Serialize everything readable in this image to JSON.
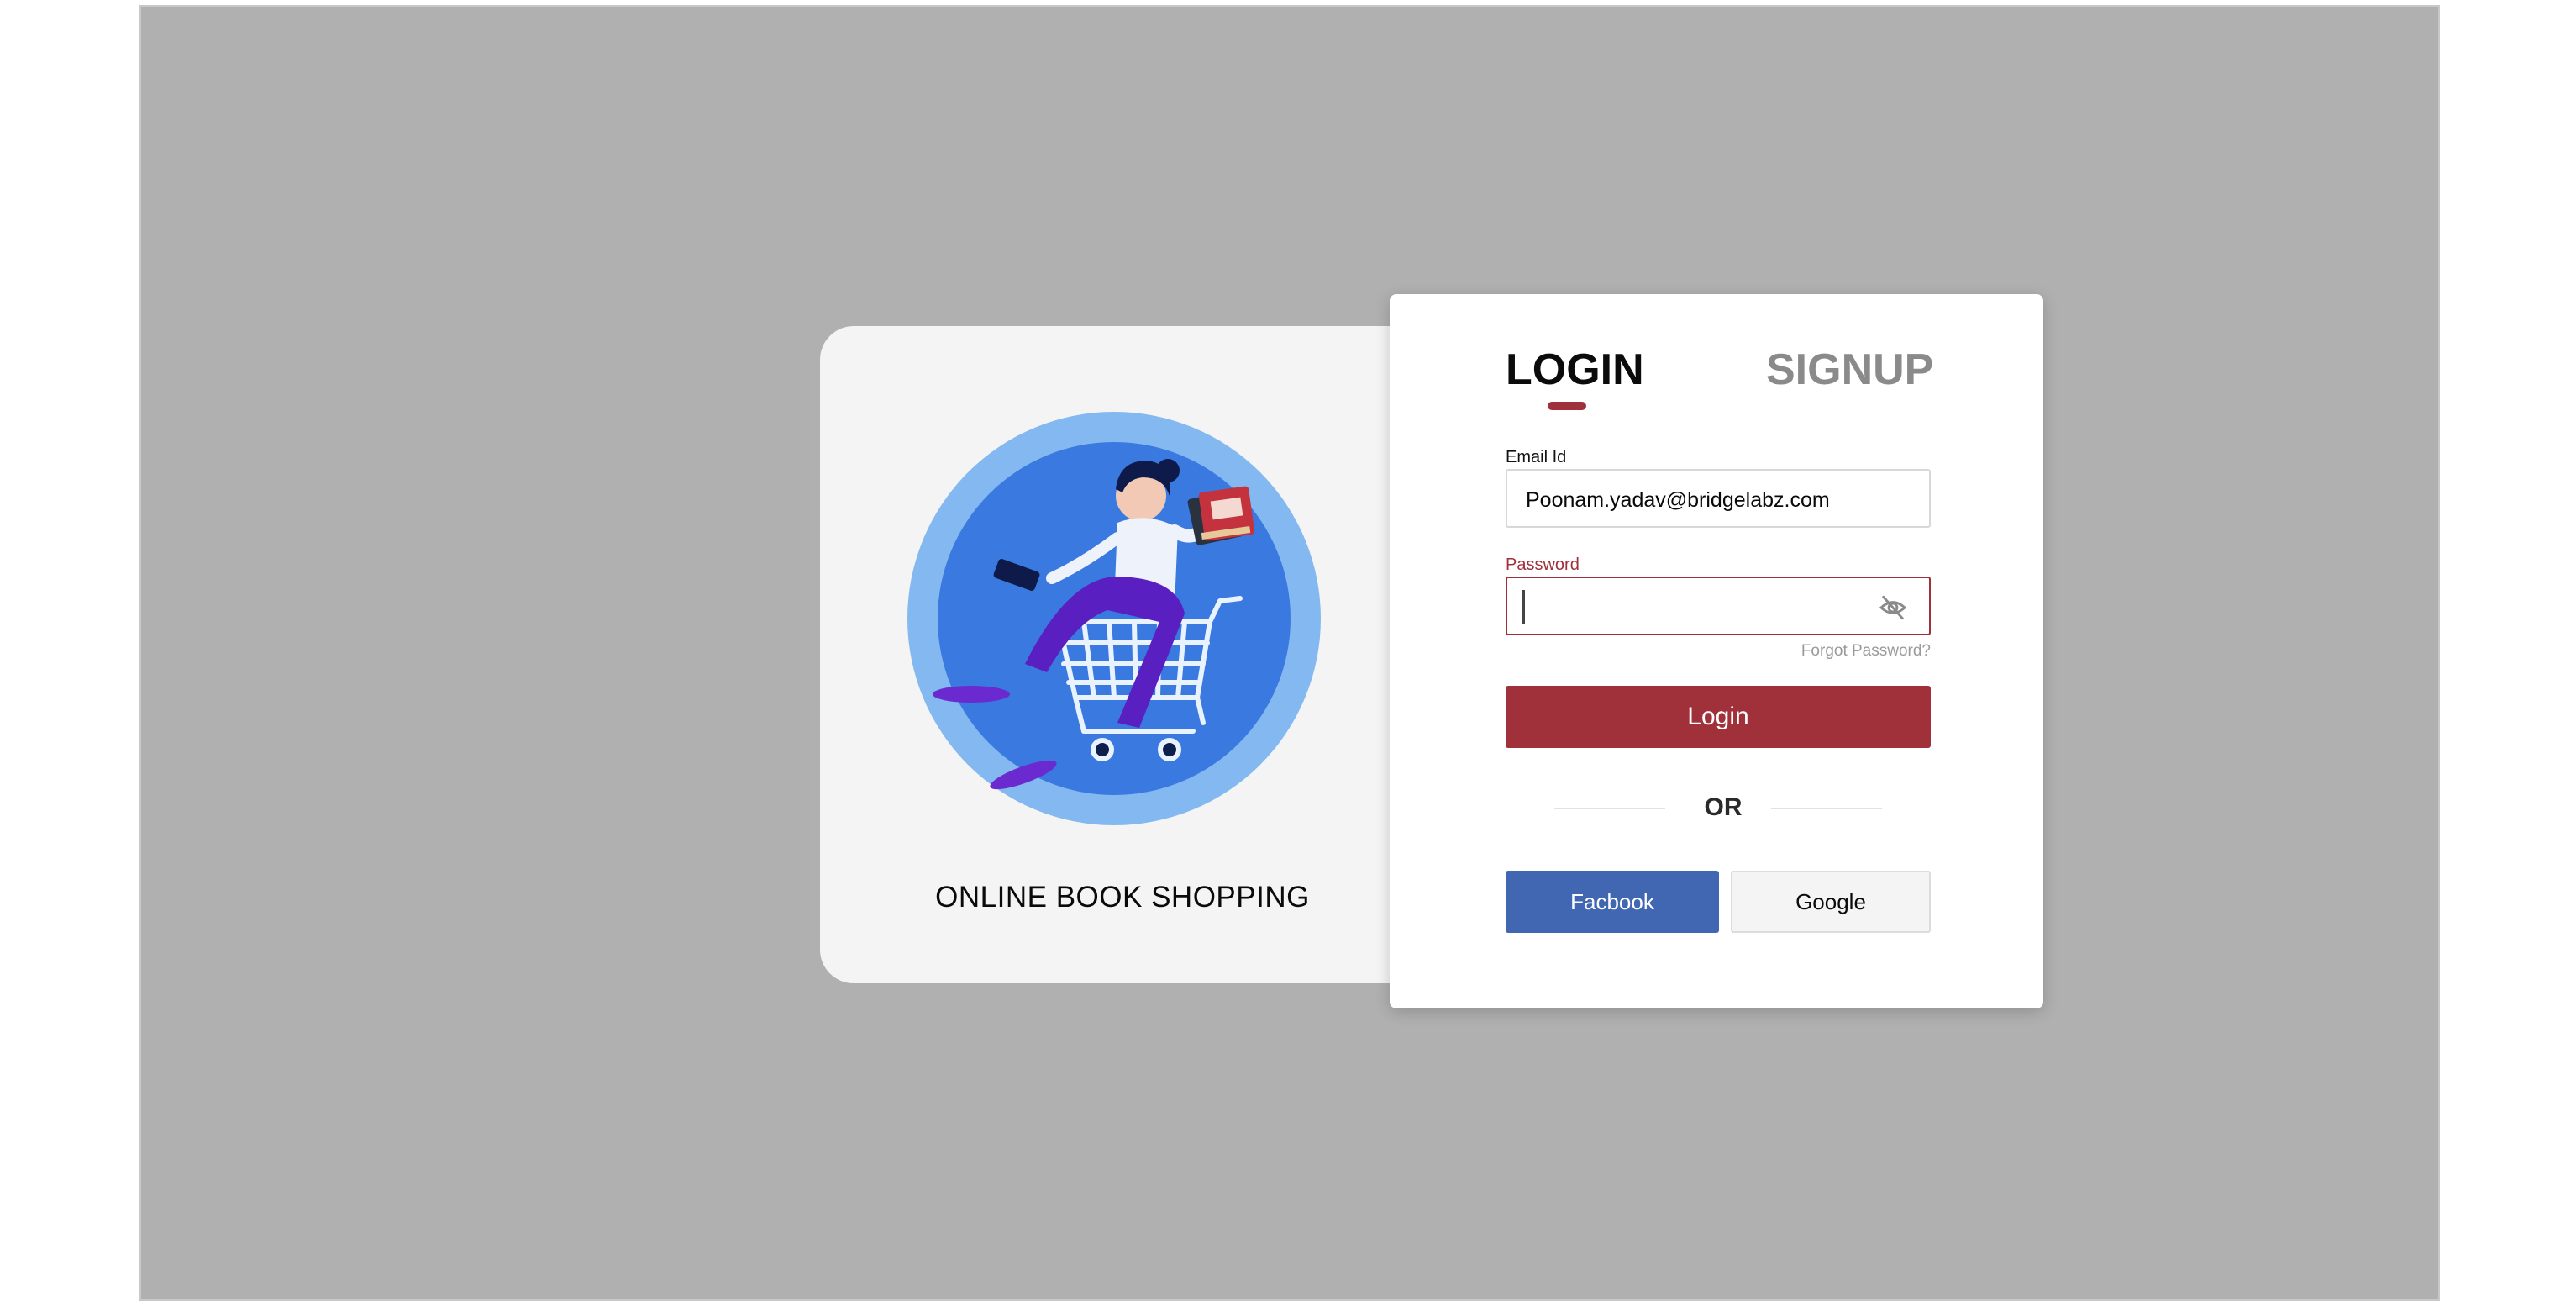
{
  "brand": {
    "tagline": "ONLINE BOOK SHOPPING"
  },
  "tabs": {
    "login": "LOGIN",
    "signup": "SIGNUP",
    "active": "login"
  },
  "form": {
    "email_label": "Email Id",
    "email_value": "Poonam.yadav@bridgelabz.com",
    "password_label": "Password",
    "password_value": "",
    "forgot_label": "Forgot Password?",
    "login_label": "Login",
    "or_label": "OR"
  },
  "social": {
    "facebook_label": "Facbook",
    "google_label": "Google"
  },
  "icons": {
    "password_toggle": "eye-off-icon",
    "illustration": "shopping-cart-illustration"
  },
  "colors": {
    "accent": "#a0303a",
    "facebook": "#4166b2",
    "backdrop": "#b0b0b0"
  }
}
